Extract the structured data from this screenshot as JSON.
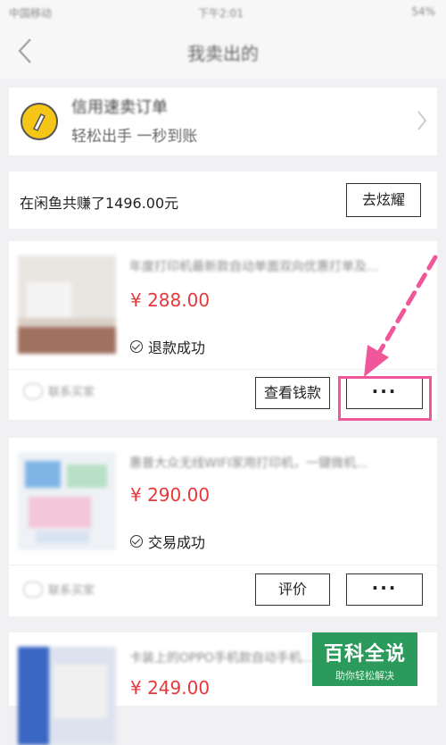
{
  "status_bar": {
    "carrier": "中国移动",
    "time": "下午2:01",
    "battery": "54%"
  },
  "nav": {
    "title": "我卖出的"
  },
  "promo": {
    "title": "信用速卖订单",
    "subtitle": "轻松出手 一秒到账"
  },
  "earnings": {
    "text": "在闲鱼共赚了1496.00元",
    "button": "去炫耀"
  },
  "orders": [
    {
      "title": "年度打印机最新款自动单面双向优惠打单及...",
      "price": "¥ 288.00",
      "status": "退款成功",
      "contact": "联系买家",
      "button_primary": "查看钱款",
      "button_more": "···"
    },
    {
      "title": "惠普大众无线WIFI家用打印机，一键微机...",
      "price": "¥ 290.00",
      "status": "交易成功",
      "contact": "联系买家",
      "button_primary": "评价",
      "button_more": "···"
    },
    {
      "title": "卡装上的OPPO手机款自动手机...",
      "price": "¥ 249.00"
    }
  ],
  "watermark": {
    "title": "百科全说",
    "subtitle": "助你轻松解决"
  },
  "colors": {
    "price": "#e5393c",
    "highlight": "#f0569a",
    "background": "#f1f1f3",
    "watermark": "#2b9a5a"
  }
}
